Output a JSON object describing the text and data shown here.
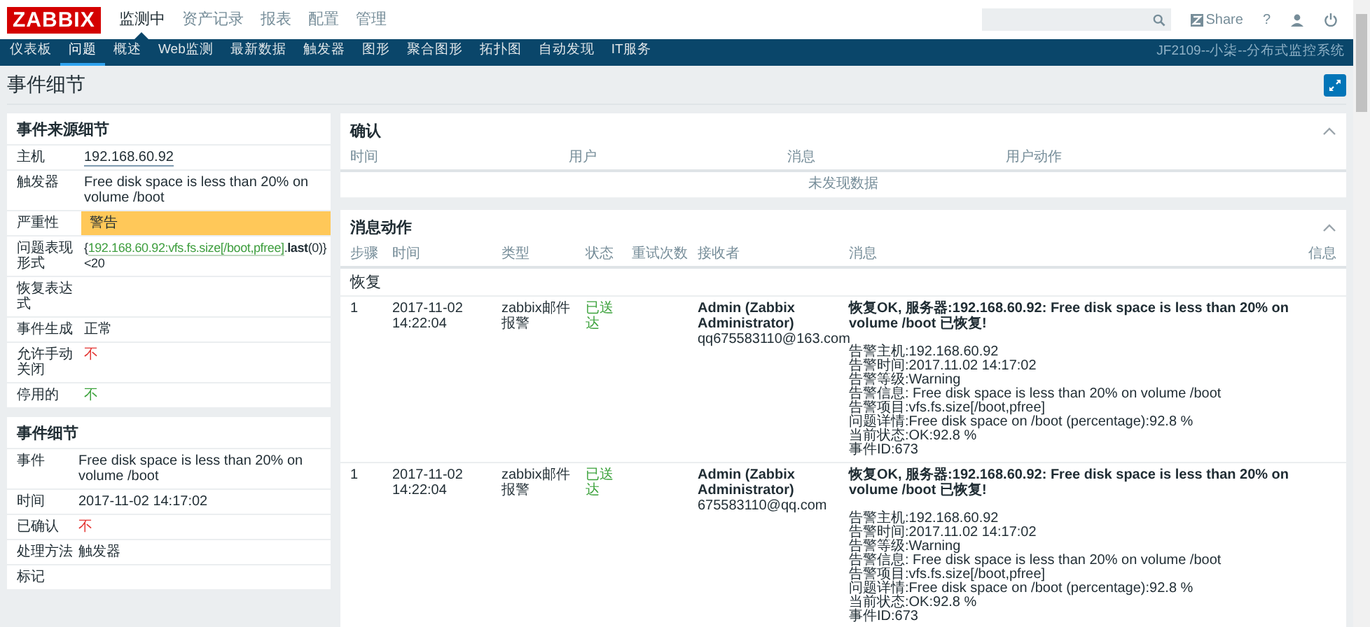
{
  "header": {
    "logo": "ZABBIX",
    "menu": [
      {
        "label": "监测中",
        "selected": true
      },
      {
        "label": "资产记录",
        "selected": false
      },
      {
        "label": "报表",
        "selected": false
      },
      {
        "label": "配置",
        "selected": false
      },
      {
        "label": "管理",
        "selected": false
      }
    ],
    "share": "Share",
    "help": "?"
  },
  "subnav": {
    "items": [
      {
        "label": "仪表板",
        "selected": false
      },
      {
        "label": "问题",
        "selected": true
      },
      {
        "label": "概述",
        "selected": false
      },
      {
        "label": "Web监测",
        "selected": false
      },
      {
        "label": "最新数据",
        "selected": false
      },
      {
        "label": "触发器",
        "selected": false
      },
      {
        "label": "图形",
        "selected": false
      },
      {
        "label": "聚合图形",
        "selected": false
      },
      {
        "label": "拓扑图",
        "selected": false
      },
      {
        "label": "自动发现",
        "selected": false
      },
      {
        "label": "IT服务",
        "selected": false
      }
    ],
    "server_name": "JF2109--小柒--分布式监控系统"
  },
  "page_title": "事件细节",
  "source_details": {
    "title": "事件来源细节",
    "rows": [
      {
        "label": "主机",
        "kind": "link",
        "value": "192.168.60.92"
      },
      {
        "label": "触发器",
        "kind": "text",
        "value": "Free disk space is less than 20% on volume /boot"
      },
      {
        "label": "严重性",
        "kind": "severity",
        "value": "警告",
        "color": "#ffc859"
      },
      {
        "label": "问题表现形式",
        "kind": "expression",
        "parts": [
          {
            "kind": "plain",
            "text": "{"
          },
          {
            "kind": "link",
            "text": "192.168.60.92:vfs.fs.size[/boot,pfree]"
          },
          {
            "kind": "plain",
            "text": "."
          },
          {
            "kind": "function",
            "text": "last"
          },
          {
            "kind": "plain",
            "text": "(0)}<20"
          }
        ]
      },
      {
        "label": "恢复表达式",
        "kind": "text"
      },
      {
        "label": "事件生成",
        "kind": "text",
        "value": "正常"
      },
      {
        "label": "允许手动关闭",
        "kind": "flag",
        "value": "不",
        "ok": false
      },
      {
        "label": "停用的",
        "kind": "flag",
        "value": "不",
        "ok": true
      }
    ]
  },
  "event_details": {
    "title": "事件细节",
    "rows": [
      {
        "label": "事件",
        "kind": "text",
        "value": "Free disk space is less than 20% on volume /boot"
      },
      {
        "label": "时间",
        "kind": "text",
        "value": "2017-11-02 14:17:02"
      },
      {
        "label": "已确认",
        "kind": "flag",
        "value": "不",
        "ok": false
      },
      {
        "label": "处理方法",
        "kind": "text",
        "value": "触发器"
      },
      {
        "label": "标记",
        "kind": "text"
      }
    ]
  },
  "acknowledgements": {
    "title": "确认",
    "columns": [
      "时间",
      "用户",
      "消息",
      "用户动作"
    ],
    "empty_text": "未发现数据"
  },
  "message_actions": {
    "title": "消息动作",
    "columns": [
      "步骤",
      "时间",
      "类型",
      "状态",
      "重试次数",
      "接收者",
      "消息",
      "信息"
    ],
    "group": "恢复",
    "rows": [
      {
        "step": "1",
        "time": "2017-11-02 14:22:04",
        "type": "zabbix邮件报警",
        "status": "已送达",
        "delivered": true,
        "recipient_name": "Admin (Zabbix Administrator)",
        "recipient_address": "qq675583110@163.com",
        "subject": "恢复OK, 服务器:192.168.60.92: Free disk space is less than 20% on volume /boot 已恢复!",
        "body": [
          "告警主机:192.168.60.92",
          "告警时间:2017.11.02 14:17:02",
          "告警等级:Warning",
          "告警信息: Free disk space is less than 20% on volume /boot",
          "告警项目:vfs.fs.size[/boot,pfree]",
          "问题详情:Free disk space on /boot (percentage):92.8 %",
          "当前状态:OK:92.8 %",
          "事件ID:673"
        ]
      },
      {
        "step": "1",
        "time": "2017-11-02 14:22:04",
        "type": "zabbix邮件报警",
        "status": "已送达",
        "delivered": true,
        "recipient_name": "Admin (Zabbix Administrator)",
        "recipient_address": "675583110@qq.com",
        "subject": "恢复OK, 服务器:192.168.60.92: Free disk space is less than 20% on volume /boot 已恢复!",
        "body": [
          "告警主机:192.168.60.92",
          "告警时间:2017.11.02 14:17:02",
          "告警等级:Warning",
          "告警信息: Free disk space is less than 20% on volume /boot",
          "告警项目:vfs.fs.size[/boot,pfree]",
          "问题详情:Free disk space on /boot (percentage):92.8 %",
          "当前状态:OK:92.8 %",
          "事件ID:673"
        ]
      }
    ]
  }
}
